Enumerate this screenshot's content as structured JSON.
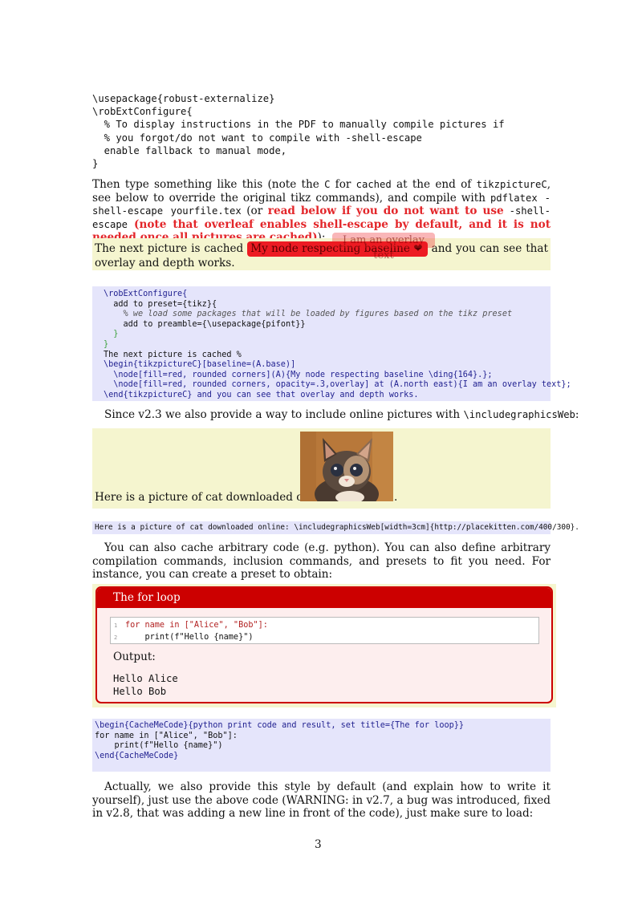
{
  "code_block_1": {
    "lines": [
      "\\usepackage{robust-externalize}",
      "\\robExtConfigure{",
      "  % To display instructions in the PDF to manually compile pictures if",
      "  % you forgot/do not want to compile with -shell-escape",
      "  enable fallback to manual mode,",
      "}"
    ]
  },
  "para1": {
    "t1": "Then type something like this (note the ",
    "c1": "C",
    "t2": " for ",
    "c2": "cached",
    "t3": " at the end of ",
    "c3": "tikzpictureC",
    "t4": ", see below to override the original tikz commands), and compile with ",
    "c4": "pdflatex -shell-escape yourfile.tex",
    "t5": " (or ",
    "r1": "read below if you do not want to use ",
    "c5": "-shell-escape",
    "r2": " (note that overleaf enables shell-escape by default, and it is not needed once all pictures are cached)",
    "t6": "):"
  },
  "demo1": {
    "before": "The next picture is cached ",
    "node_text": "My node respecting baseline ❤",
    "after": " and you can see that overlay and depth works.",
    "overlay_text": "I am an overlay text"
  },
  "code_block_2": {
    "l1": "\\robExtConfigure{",
    "l2": "add to preset={tikz}{",
    "l3": "% we load some packages that will be loaded by figures based on the tikz preset",
    "l4": "add to preamble={\\usepackage{pifont}}",
    "l5": "}",
    "l6": "}",
    "l7": "The next picture is cached %",
    "l8": "\\begin{tikzpictureC}[baseline=(A.base)]",
    "l9": "\\node[fill=red, rounded corners](A){My node respecting baseline \\ding{164}.};",
    "l10": "\\node[fill=red, rounded corners, opacity=.3,overlay] at (A.north east){I am an overlay text};",
    "l11": "\\end{tikzpictureC} and you can see that overlay and depth works."
  },
  "para2": {
    "text": "Since v2.3 we also provide a way to include online pictures with ",
    "cmd": "\\includegraphicsWeb",
    "end": ":"
  },
  "demo2": {
    "label": "Here is a picture of cat downloaded online: ",
    "dot": "."
  },
  "code_block_3": {
    "text": "Here is a picture of cat downloaded online: \\includegraphicsWeb[width=3cm]{http://placekitten.com/400/300}."
  },
  "para3": {
    "text": "You can also cache arbitrary code (e.g. python). You can also define arbitrary compilation commands, inclusion commands, and presets to fit you need. For instance, you can create a preset to obtain:"
  },
  "tcolorbox": {
    "title": "The for loop",
    "code_line_1": "for name in [\"Alice\", \"Bob\"]:",
    "code_line_2": "    print(f\"Hello {name}\")",
    "output_label": "Output:",
    "output_1": "Hello Alice",
    "output_2": "Hello Bob"
  },
  "code_block_4": {
    "lines": [
      "\\begin{CacheMeCode}{python print code and result, set title={The for loop}}",
      "for name in [\"Alice\", \"Bob\"]:",
      "    print(f\"Hello {name}\")",
      "\\end{CacheMeCode}"
    ]
  },
  "para4": {
    "text": "Actually, we also provide this style by default (and explain how to write it yourself), just use the above code (WARNING: in v2.7, a bug was introduced, fixed in v2.8, that was adding a new line in front of the code), just make sure to load:"
  },
  "page_number": "3"
}
